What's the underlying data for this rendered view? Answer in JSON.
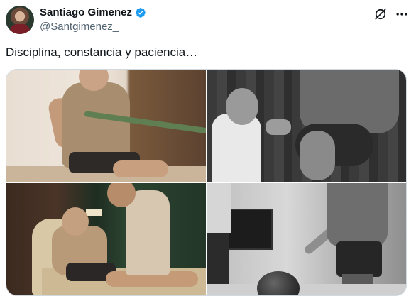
{
  "author": {
    "display_name": "Santiago Gimenez",
    "handle": "@Santgimenez_",
    "verified_color": "#1d9bf0",
    "avatar_icon": "profile-photo"
  },
  "actions": {
    "grok_icon": "grok-icon",
    "more_icon": "more-options-icon"
  },
  "tweet": {
    "text": "Disciplina, constancia y paciencia…"
  },
  "media": {
    "photos": [
      {
        "name": "photo-band-stretch"
      },
      {
        "name": "photo-trainer-assist"
      },
      {
        "name": "photo-massage-table"
      },
      {
        "name": "photo-balance-exercise"
      }
    ]
  },
  "colors": {
    "text_primary": "#0f1419",
    "text_secondary": "#536471",
    "border": "#cfd9de",
    "verified": "#1d9bf0"
  }
}
